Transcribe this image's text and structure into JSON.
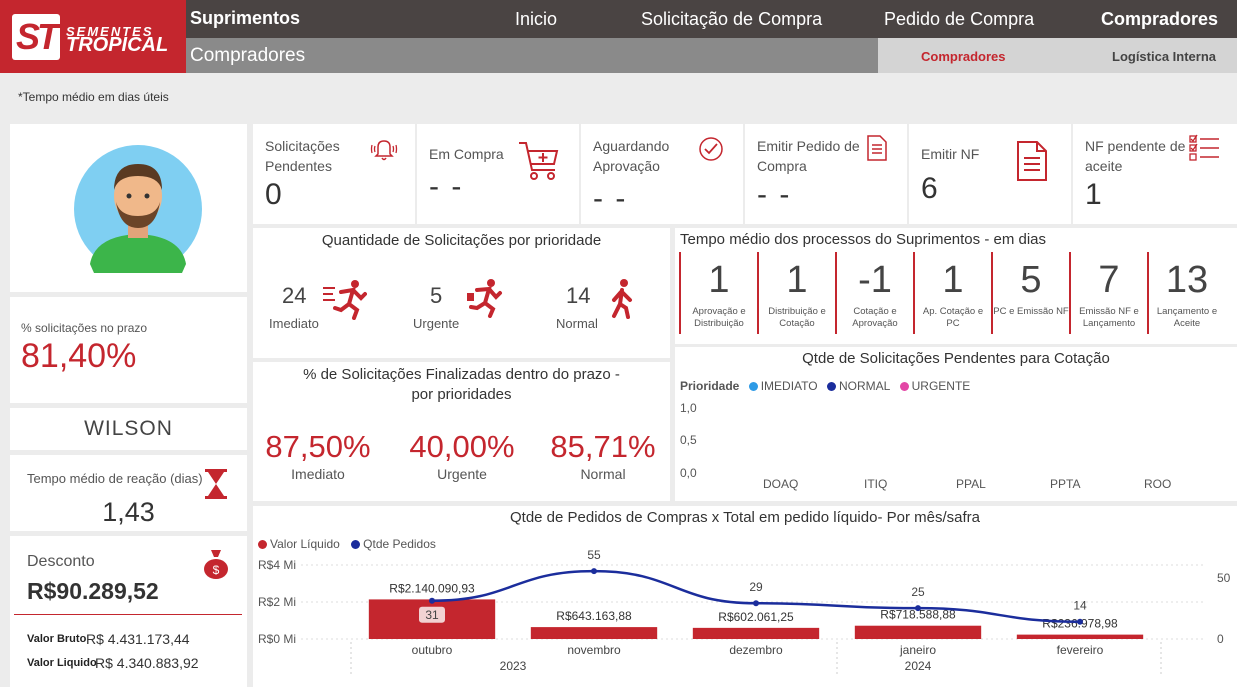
{
  "brand": {
    "line1": "SEMENTES",
    "line2": "TROPICAL",
    "mark": "ST"
  },
  "header": {
    "title": "Suprimentos",
    "nav": [
      "Inicio",
      "Solicitação de Compra",
      "Pedido de Compra",
      "Compradores"
    ],
    "subtitle": "Compradores",
    "subtabs": [
      "Compradores",
      "Logística Interna"
    ]
  },
  "note": "*Tempo médio em dias úteis",
  "kpis": [
    {
      "label": "Solicitações Pendentes",
      "value": "0",
      "icon": "bell-icon"
    },
    {
      "label": "Em Compra",
      "value": "- -",
      "icon": "cart-icon"
    },
    {
      "label": "Aguardando Aprovação",
      "value": "- -",
      "icon": "check-circle-icon"
    },
    {
      "label": "Emitir Pedido de Compra",
      "value": "- -",
      "icon": "document-icon"
    },
    {
      "label": "Emitir NF",
      "value": "6",
      "icon": "invoice-icon"
    },
    {
      "label": "NF pendente de aceite",
      "value": "1",
      "icon": "checklist-icon"
    }
  ],
  "left": {
    "pct_label": "% solicitações no prazo",
    "pct_value": "81,40%",
    "name": "WILSON",
    "reaction_label": "Tempo médio de reação (dias)",
    "reaction_value": "1,43",
    "discount_label": "Desconto",
    "discount_value": "R$90.289,52",
    "gross_label": "Valor Bruto",
    "gross_value": "R$ 4.431.173,44",
    "net_label": "Valor Liquido",
    "net_value": "R$ 4.340.883,92"
  },
  "priority": {
    "title": "Quantidade de Solicitações por prioridade",
    "items": [
      {
        "count": "24",
        "label": "Imediato"
      },
      {
        "count": "5",
        "label": "Urgente"
      },
      {
        "count": "14",
        "label": "Normal"
      }
    ]
  },
  "finalized": {
    "title": "% de Solicitações Finalizadas dentro do prazo - por prioridades",
    "items": [
      {
        "pct": "87,50%",
        "label": "Imediato"
      },
      {
        "pct": "40,00%",
        "label": "Urgente"
      },
      {
        "pct": "85,71%",
        "label": "Normal"
      }
    ]
  },
  "process_time": {
    "title": "Tempo médio dos processos do Suprimentos - em dias",
    "steps": [
      {
        "value": "1",
        "label": "Aprovação e Distribuição"
      },
      {
        "value": "1",
        "label": "Distribuição e Cotação"
      },
      {
        "value": "-1",
        "label": "Cotação e Aprovação"
      },
      {
        "value": "1",
        "label": "Ap. Cotação e PC"
      },
      {
        "value": "5",
        "label": "PC e Emissão NF"
      },
      {
        "value": "7",
        "label": "Emissão NF e Lançamento"
      },
      {
        "value": "13",
        "label": "Lançamento e Aceite"
      }
    ]
  },
  "chart_data": [
    {
      "type": "bar",
      "title": "Qtde de Solicitações Pendentes para Cotação",
      "legend_title": "Prioridade",
      "series": [
        {
          "name": "IMEDIATO",
          "color": "#2e9be6"
        },
        {
          "name": "NORMAL",
          "color": "#1b2d9c"
        },
        {
          "name": "URGENTE",
          "color": "#e347a6"
        }
      ],
      "categories": [
        "DOAQ",
        "ITIQ",
        "PPAL",
        "PPTA",
        "ROO"
      ],
      "yticks": [
        "1,0",
        "0,5",
        "0,0"
      ],
      "ylim": [
        0,
        1
      ],
      "legend_position": "top-left"
    },
    {
      "type": "bar",
      "title": "Qtde de Pedidos de Compras x Total em pedido líquido- Por mês/safra",
      "categories": [
        "outubro",
        "novembro",
        "dezembro",
        "janeiro",
        "fevereiro"
      ],
      "years": [
        {
          "label": "2023"
        },
        {
          "label": "2024"
        }
      ],
      "series": [
        {
          "name": "Valor Líquido",
          "color": "#c4262e",
          "values": [
            2140090.93,
            643163.88,
            602061.25,
            718588.88,
            236978.98
          ],
          "labels": [
            "R$2.140.090,93",
            "R$643.163,88",
            "R$602.061,25",
            "R$718.588,88",
            "R$236.978,98"
          ]
        },
        {
          "name": "Qtde Pedidos",
          "color": "#1b2d9c",
          "values": [
            31,
            55,
            29,
            25,
            14
          ],
          "labels": [
            "31",
            "55",
            "29",
            "25",
            "14"
          ]
        }
      ],
      "yticks_left": [
        "R$4 Mi",
        "R$2 Mi",
        "R$0 Mi"
      ],
      "yticks_right": [
        "50",
        "0"
      ],
      "ylim_left": [
        0,
        4000000
      ],
      "ylim_right": [
        0,
        60
      ],
      "legend_position": "top-left"
    }
  ]
}
